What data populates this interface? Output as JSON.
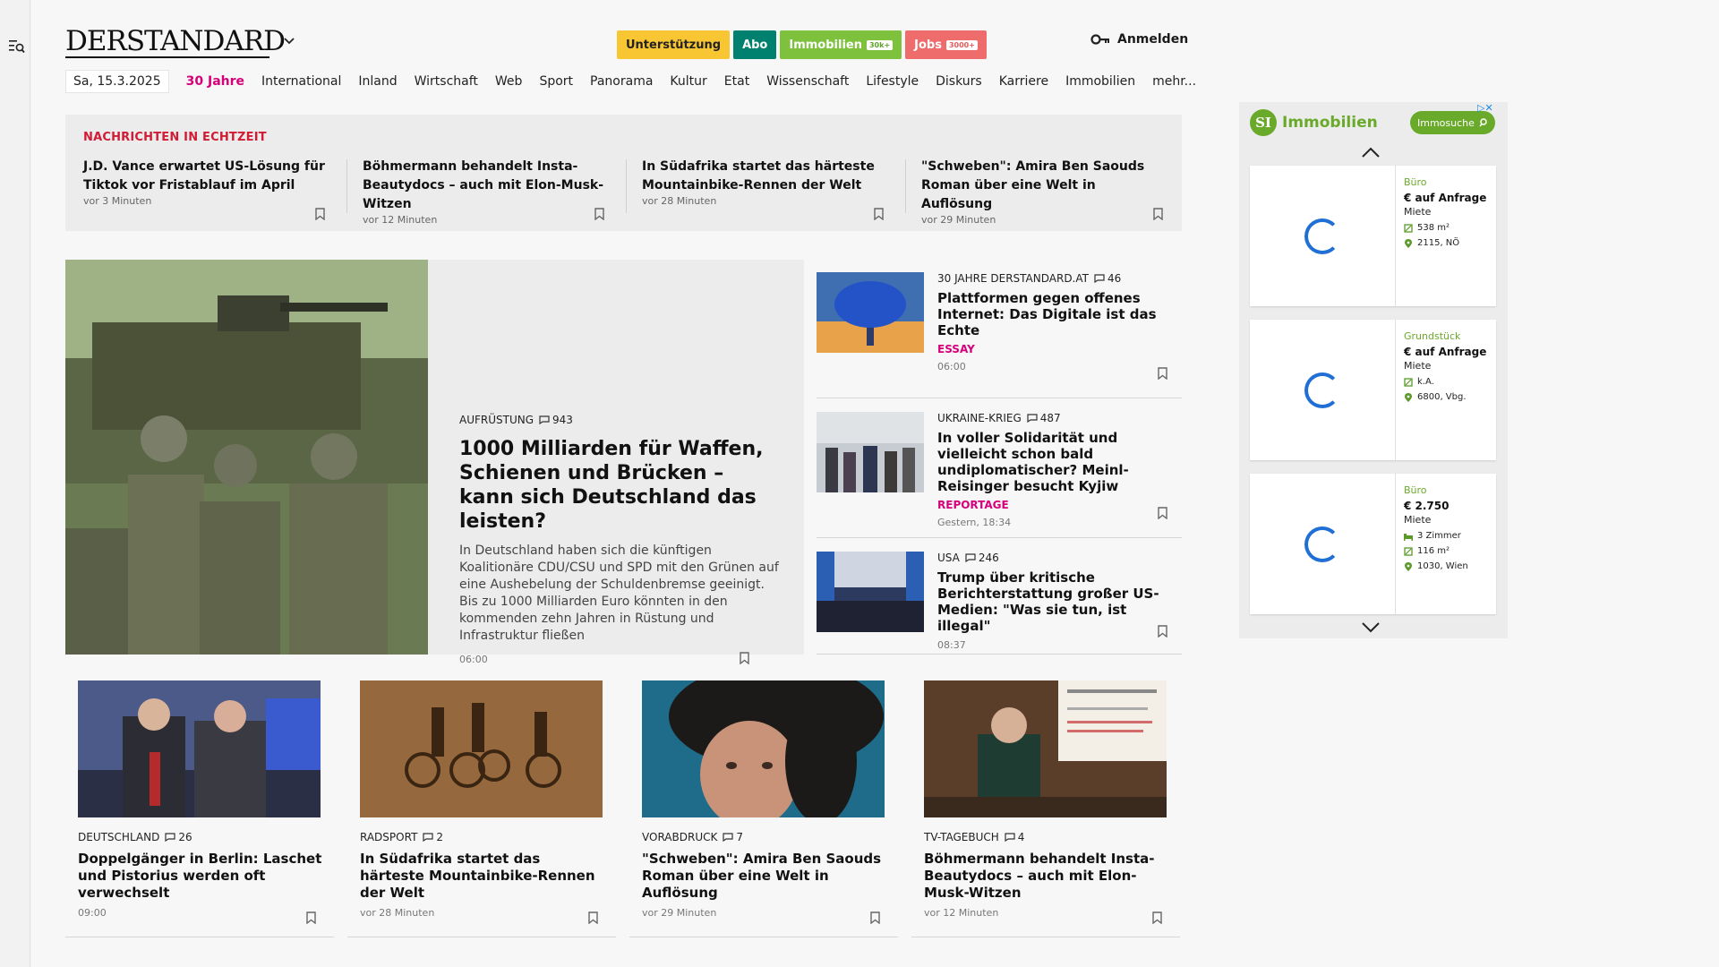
{
  "header": {
    "logo": "DERSTANDARD",
    "pills": {
      "support": "Unterstützung",
      "abo": "Abo",
      "immobilien": "Immobilien",
      "immobilien_badge": "30k+",
      "jobs": "Jobs",
      "jobs_badge": "3000+"
    },
    "login": "Anmelden"
  },
  "nav": {
    "date": "Sa, 15.3.2025",
    "items": [
      "30 Jahre",
      "International",
      "Inland",
      "Wirtschaft",
      "Web",
      "Sport",
      "Panorama",
      "Kultur",
      "Etat",
      "Wissenschaft",
      "Lifestyle",
      "Diskurs",
      "Karriere",
      "Immobilien",
      "mehr..."
    ]
  },
  "ticker": {
    "title": "NACHRICHTEN IN ECHTZEIT",
    "items": [
      {
        "title": "J.D. Vance erwartet US-Lösung für Tiktok vor Fristablauf im April",
        "time": "vor 3 Minuten"
      },
      {
        "title": "Böhmermann behandelt Insta-Beautydocs – auch mit Elon-Musk-Witzen",
        "time": "vor 12 Minuten"
      },
      {
        "title": "In Südafrika startet das härteste Mountainbike-Rennen der Welt",
        "time": "vor 28 Minuten"
      },
      {
        "title": "\"Schweben\": Amira Ben Saouds Roman über eine Welt in Auflösung",
        "time": "vor 29 Minuten"
      }
    ]
  },
  "feature": {
    "kicker": "AUFRÜSTUNG",
    "comments": "943",
    "title": "1000 Milliarden für Waffen, Schienen und Brücken – kann sich Deutschland das leisten?",
    "teaser": "In Deutschland haben sich die künftigen Koalitionäre CDU/CSU und SPD mit den Grünen auf eine Aushebelung der Schuldenbremse geeinigt. Bis zu 1000 Milliarden Euro könnten in den kommenden zehn Jahren in Rüstung und Infrastruktur fließen",
    "time": "06:00"
  },
  "side": [
    {
      "kicker": "30 JAHRE DERSTANDARD.AT",
      "comments": "46",
      "title": "Plattformen gegen offenes Internet: Das Digitale ist das Echte",
      "tag": "ESSAY",
      "time": "06:00"
    },
    {
      "kicker": "UKRAINE-KRIEG",
      "comments": "487",
      "title": "In voller Solidarität und vielleicht schon bald undiplomatischer? Meinl-Reisinger besucht Kyjiw",
      "tag": "REPORTAGE",
      "time": "Gestern, 18:34"
    },
    {
      "kicker": "USA",
      "comments": "246",
      "title": "Trump über kritische Berichterstattung großer US-Medien: \"Was sie tun, ist illegal\"",
      "tag": "",
      "time": "08:37"
    }
  ],
  "cards": [
    {
      "kicker": "DEUTSCHLAND",
      "comments": "26",
      "title": "Doppelgänger in Berlin: Laschet und Pistorius werden oft verwechselt",
      "time": "09:00"
    },
    {
      "kicker": "RADSPORT",
      "comments": "2",
      "title": "In Südafrika startet das härteste Mountainbike-Rennen der Welt",
      "time": "vor 28 Minuten"
    },
    {
      "kicker": "VORABDRUCK",
      "comments": "7",
      "title": "\"Schweben\": Amira Ben Saouds Roman über eine Welt in Auflösung",
      "time": "vor 29 Minuten"
    },
    {
      "kicker": "TV-TAGEBUCH",
      "comments": "4",
      "title": "Böhmermann behandelt Insta-Beautydocs – auch mit Elon-Musk-Witzen",
      "time": "vor 12 Minuten"
    }
  ],
  "ad": {
    "logo_letters": "SI",
    "brand": "Immobilien",
    "search": "Immosuche",
    "listings": [
      {
        "type": "Büro",
        "price": "€ auf Anfrage",
        "sub": "Miete",
        "rows": [
          "538 m²",
          "2115, NÖ"
        ]
      },
      {
        "type": "Grundstück",
        "price": "€ auf Anfrage",
        "sub": "Miete",
        "rows": [
          "k.A.",
          "6800, Vbg."
        ]
      },
      {
        "type": "Büro",
        "price": "€ 2.750",
        "sub": "Miete",
        "rows": [
          "3 Zimmer",
          "116 m²",
          "1030, Wien"
        ]
      }
    ]
  },
  "colors": {
    "support": "#f9c633",
    "abo": "#00806e",
    "immobilien": "#7dc13d",
    "jobs": "#ef6c6c",
    "ticker_title": "#d21b34",
    "accent_magenta": "#d6007a",
    "ad_green": "#6aaa2b",
    "spinner": "#1f6fd6"
  }
}
